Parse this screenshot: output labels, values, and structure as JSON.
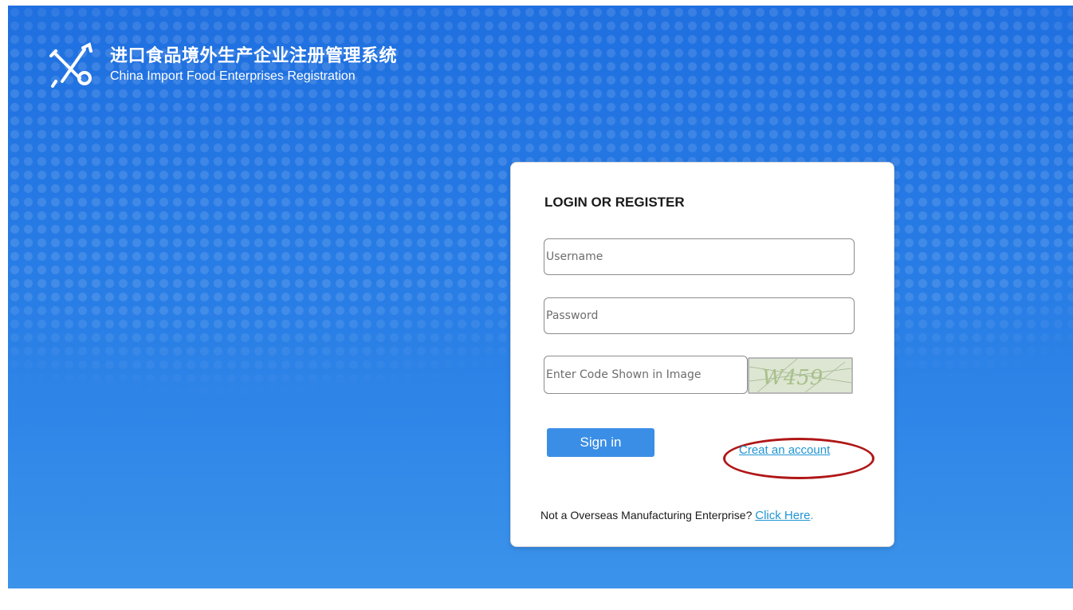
{
  "brand": {
    "title_cn": "进口食品境外生产企业注册管理系统",
    "title_en": "China Import Food Enterprises Registration"
  },
  "login": {
    "heading": "LOGIN OR REGISTER",
    "username_placeholder": "Username",
    "password_placeholder": "Password",
    "captcha_placeholder": "Enter Code Shown in Image",
    "captcha_text": "W459",
    "signin_label": "Sign in",
    "create_account_label": "Creat an account",
    "footer_text": "Not a Overseas Manufacturing Enterprise? ",
    "footer_link": "Click Here",
    "footer_end": "."
  },
  "colors": {
    "background": "#2a7fe6",
    "signin_button": "#3a8ee6",
    "link": "#2196d3",
    "highlight_ring": "#b01717"
  }
}
